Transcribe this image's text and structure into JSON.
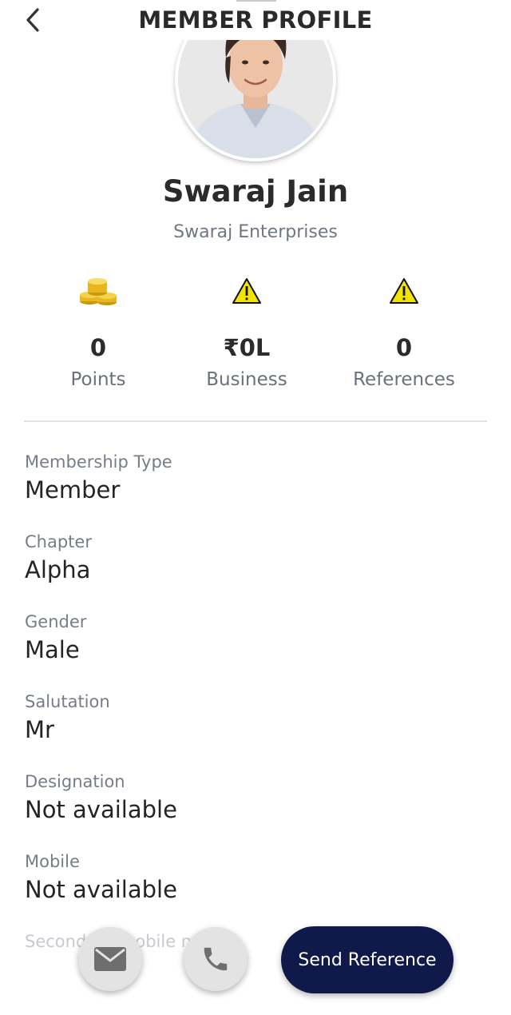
{
  "header": {
    "title": "MEMBER PROFILE"
  },
  "profile": {
    "name": "Swaraj Jain",
    "company": "Swaraj Enterprises"
  },
  "stats": [
    {
      "icon": "coins-icon",
      "value": "0",
      "label": "Points"
    },
    {
      "icon": "warning-icon",
      "value": "₹0L",
      "label": "Business"
    },
    {
      "icon": "warning-icon",
      "value": "0",
      "label": "References"
    }
  ],
  "fields": [
    {
      "label": "Membership Type",
      "value": "Member"
    },
    {
      "label": "Chapter",
      "value": "Alpha"
    },
    {
      "label": "Gender",
      "value": "Male"
    },
    {
      "label": "Salutation",
      "value": "Mr"
    },
    {
      "label": "Designation",
      "value": "Not available"
    },
    {
      "label": "Mobile",
      "value": "Not available"
    },
    {
      "label": "Secondary mobile no"
    }
  ],
  "actions": {
    "send_reference": "Send Reference"
  },
  "colors": {
    "primary": "#0f1a4a",
    "warning": "#f2e400",
    "fab": "#e3e3e3"
  }
}
